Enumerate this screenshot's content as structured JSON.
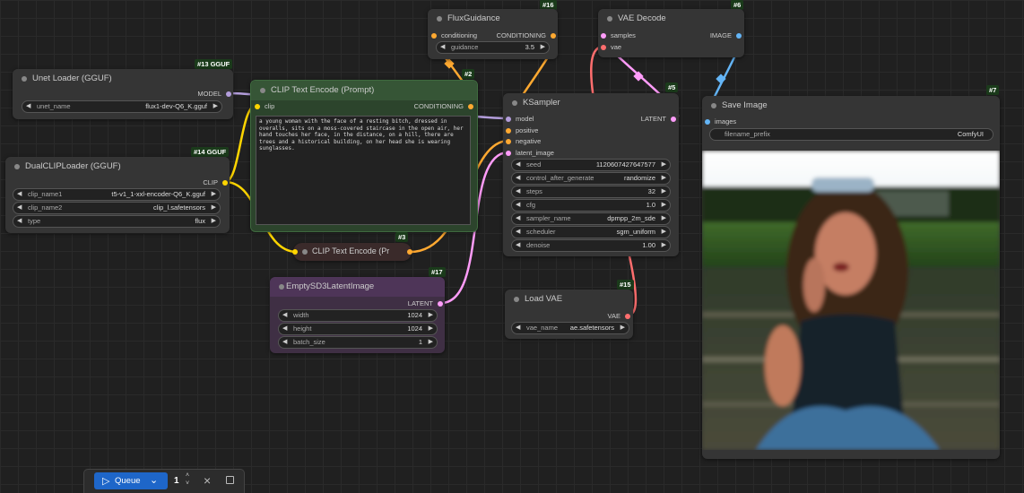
{
  "colors": {
    "clip": "#ffd500",
    "conditioning": "#ffa931",
    "model": "#b39ddb",
    "latent": "#ff9cf9",
    "vae": "#ff6e6e",
    "image": "#64b5f6"
  },
  "nodes": {
    "unet_loader": {
      "id": "#13 GGUF",
      "title": "Unet Loader (GGUF)",
      "output": "MODEL",
      "widgets": [
        {
          "label": "unet_name",
          "value": "flux1-dev-Q6_K.gguf"
        }
      ]
    },
    "dualclip": {
      "id": "#14 GGUF",
      "title": "DualCLIPLoader (GGUF)",
      "output": "CLIP",
      "widgets": [
        {
          "label": "clip_name1",
          "value": "t5-v1_1-xxl-encoder-Q6_K.gguf"
        },
        {
          "label": "clip_name2",
          "value": "clip_l.safetensors"
        },
        {
          "label": "type",
          "value": "flux"
        }
      ]
    },
    "clip_prompt": {
      "id": "#2",
      "title": "CLIP Text Encode (Prompt)",
      "input": "clip",
      "output": "CONDITIONING",
      "text": "a young woman with the face of a resting bitch, dressed in overalls, sits on a moss-covered staircase in the open air, her hand touches her face, in the distance, on a hill, there are trees and a historical building, on her head she is wearing sunglasses."
    },
    "clip_collapsed": {
      "id": "#3",
      "title": "CLIP Text Encode (Pr"
    },
    "flux_guidance": {
      "id": "#16",
      "title": "FluxGuidance",
      "input": "conditioning",
      "output": "CONDITIONING",
      "widgets": [
        {
          "label": "guidance",
          "value": "3.5"
        }
      ]
    },
    "vae_decode": {
      "id": "#6",
      "title": "VAE Decode",
      "inputs": [
        "samples",
        "vae"
      ],
      "output": "IMAGE"
    },
    "ksampler": {
      "id": "#5",
      "title": "KSampler",
      "inputs": [
        "model",
        "positive",
        "negative",
        "latent_image"
      ],
      "output": "LATENT",
      "widgets": [
        {
          "label": "seed",
          "value": "1120607427647577"
        },
        {
          "label": "control_after_generate",
          "value": "randomize"
        },
        {
          "label": "steps",
          "value": "32"
        },
        {
          "label": "cfg",
          "value": "1.0"
        },
        {
          "label": "sampler_name",
          "value": "dpmpp_2m_sde"
        },
        {
          "label": "scheduler",
          "value": "sgm_uniform"
        },
        {
          "label": "denoise",
          "value": "1.00"
        }
      ]
    },
    "empty_latent": {
      "id": "#17",
      "title": "EmptySD3LatentImage",
      "output": "LATENT",
      "widgets": [
        {
          "label": "width",
          "value": "1024"
        },
        {
          "label": "height",
          "value": "1024"
        },
        {
          "label": "batch_size",
          "value": "1"
        }
      ]
    },
    "load_vae": {
      "id": "#15",
      "title": "Load VAE",
      "output": "VAE",
      "widgets": [
        {
          "label": "vae_name",
          "value": "ae.safetensors"
        }
      ]
    },
    "save_image": {
      "id": "#7",
      "title": "Save Image",
      "input": "images",
      "widgets": [
        {
          "label": "filename_prefix",
          "value": "ComfyUI"
        }
      ]
    }
  },
  "queue": {
    "label": "Queue",
    "count": "1",
    "play_icon": "play-icon",
    "dropdown_icon": "chevron-down-icon",
    "close_icon": "close-icon",
    "stop_icon": "square-icon"
  }
}
